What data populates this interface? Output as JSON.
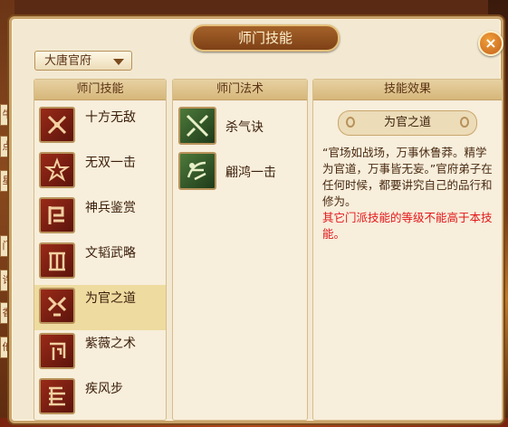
{
  "window": {
    "title": "师门技能",
    "close_label": "×"
  },
  "sect_dropdown": {
    "selected": "大唐官府"
  },
  "columns": {
    "skills": "师门技能",
    "spells": "师门法术",
    "effect": "技能效果"
  },
  "skills": [
    {
      "label": "十方无敌",
      "icon": "crossed-blades-icon"
    },
    {
      "label": "无双一击",
      "icon": "star-burst-icon"
    },
    {
      "label": "神兵鉴赏",
      "icon": "weapon-rack-icon"
    },
    {
      "label": "文韬武略",
      "icon": "scroll-book-icon"
    },
    {
      "label": "为官之道",
      "icon": "official-seal-icon"
    },
    {
      "label": "紫薇之术",
      "icon": "rune-icon"
    },
    {
      "label": "疾风步",
      "icon": "wind-step-icon"
    }
  ],
  "selected_skill_index": 4,
  "spells": [
    {
      "label": "杀气诀",
      "icon": "sword-aura-icon"
    },
    {
      "label": "翩鸿一击",
      "icon": "swan-strike-icon"
    }
  ],
  "effect": {
    "name": "为官之道",
    "description": "“官场如战场，万事休鲁莽。精学为官道，万事皆无妄。”官府弟子在任何时候，都要讲究自己的品行和修为。",
    "warning": "其它门派技能的等级不能高于本技能。"
  },
  "colors": {
    "warning": "#e3161a",
    "selected_row": "#eedba0"
  },
  "background_tags": [
    "牛",
    "点",
    "星",
    "门",
    "许",
    "香",
    "他"
  ]
}
